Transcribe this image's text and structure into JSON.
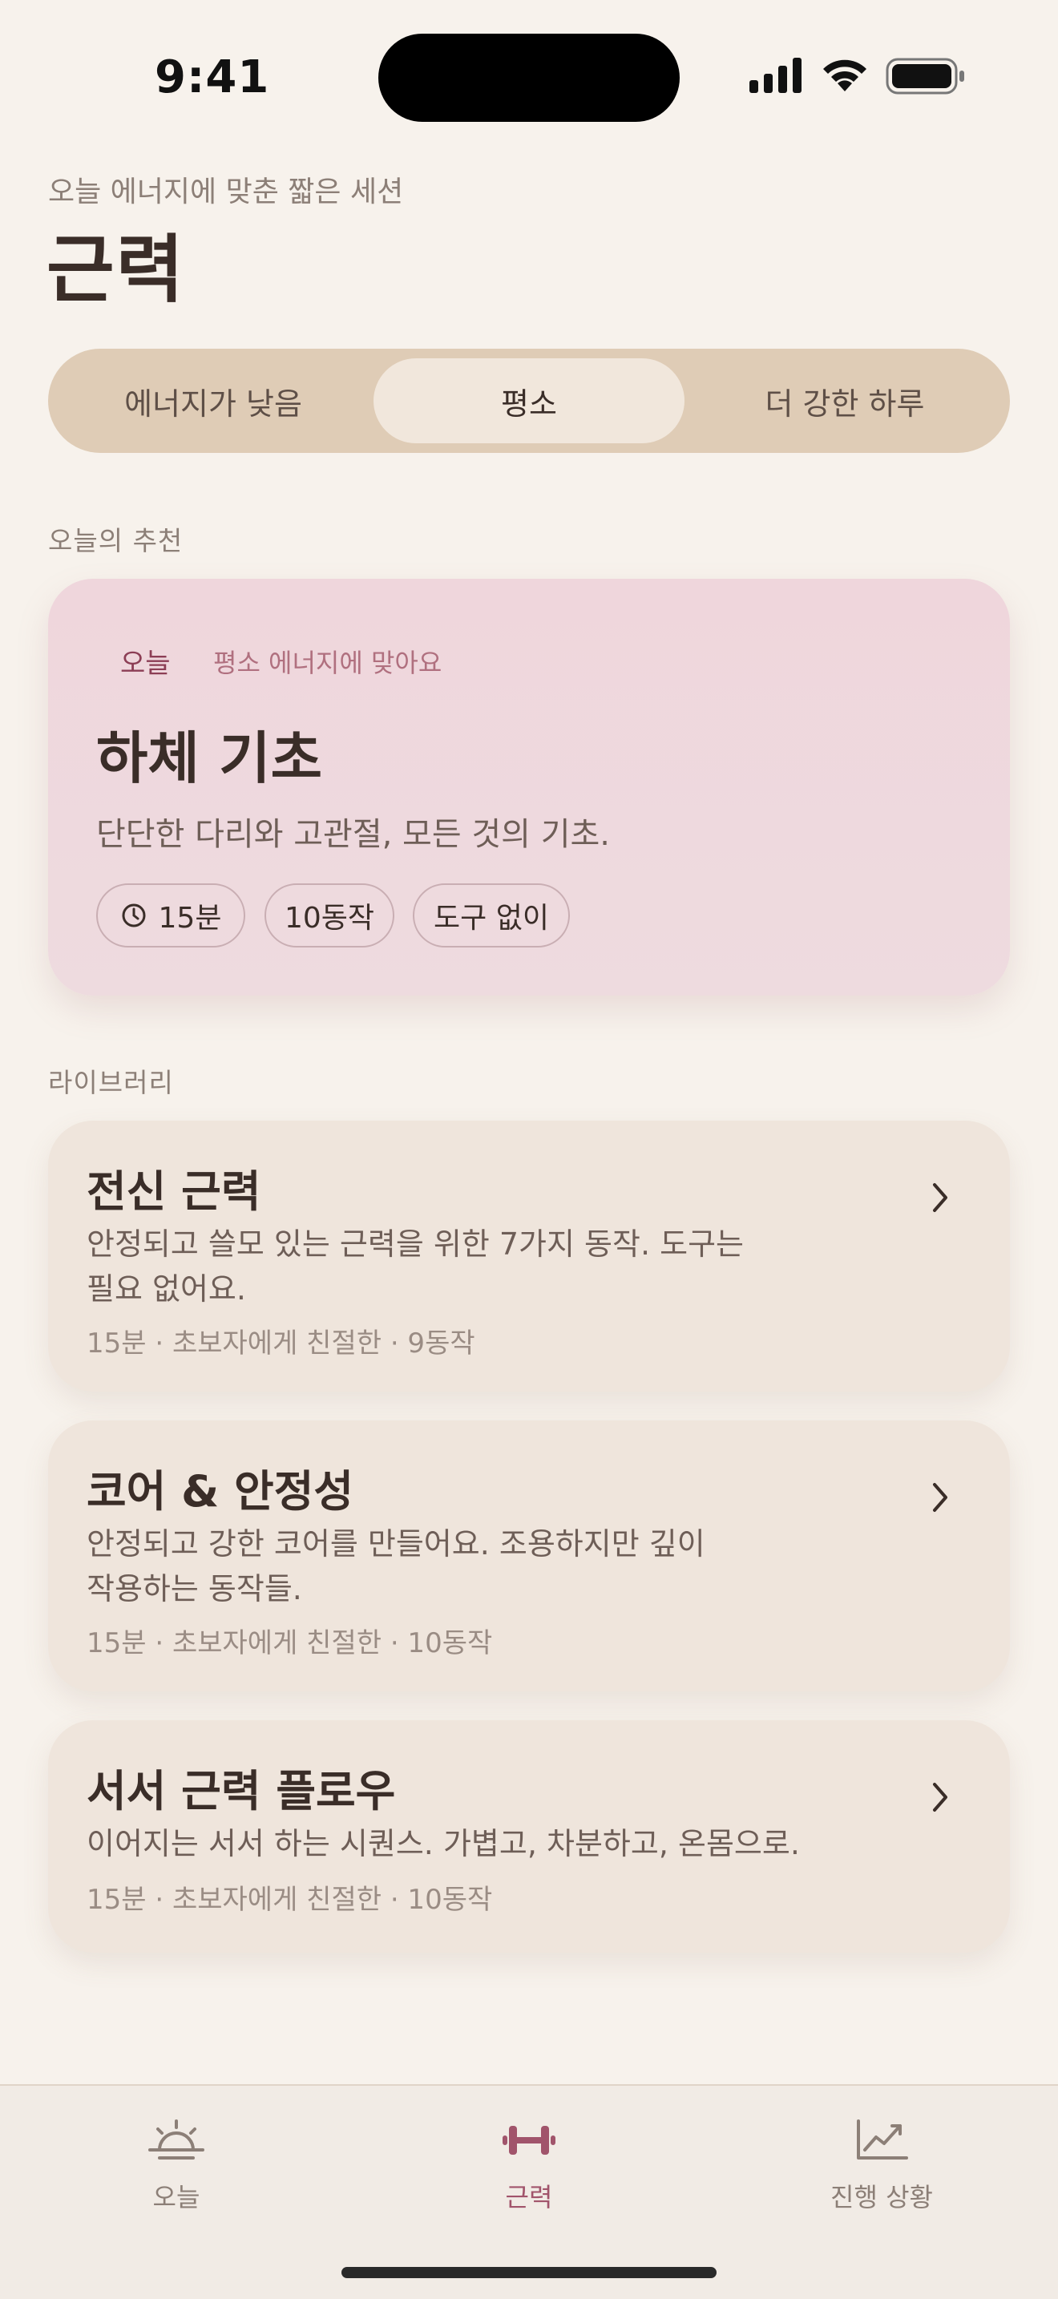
{
  "status_bar": {
    "time": "9:41"
  },
  "header": {
    "subtitle": "오늘 에너지에 맞춘 짧은 세션",
    "title": "근력"
  },
  "energy_selector": {
    "options": [
      "에너지가 낮음",
      "평소",
      "더 강한 하루"
    ],
    "selected": "평소"
  },
  "recommendation": {
    "section_label": "오늘의 추천",
    "tag": "오늘",
    "tag_note": "평소 에너지에 맞아요",
    "title": "하체 기초",
    "description": "단단한 다리와 고관절, 모든 것의 기초.",
    "pills": [
      "15분",
      "10동작",
      "도구 없이"
    ]
  },
  "library": {
    "section_label": "라이브러리",
    "items": [
      {
        "title": "전신 근력",
        "description_line1": "안정되고 쓸모 있는 근력을 위한 7가지 동작. 도구는",
        "description_line2": "필요 없어요.",
        "meta": "15분 · 초보자에게 친절한 · 9동작"
      },
      {
        "title": "코어 & 안정성",
        "description_line1": "안정되고 강한 코어를 만들어요. 조용하지만 깊이",
        "description_line2": "작용하는 동작들.",
        "meta": "15분 · 초보자에게 친절한 · 10동작"
      },
      {
        "title": "서서 근력 플로우",
        "description_line1": "이어지는 서서 하는 시퀀스. 가볍고, 차분하고, 온몸으로.",
        "meta": "15분 · 초보자에게 친절한 · 10동작"
      }
    ]
  },
  "tab_bar": {
    "tabs": [
      {
        "label": "오늘",
        "icon": "sunrise-icon"
      },
      {
        "label": "근력",
        "icon": "dumbbell-icon"
      },
      {
        "label": "진행 상황",
        "icon": "chart-line-icon"
      }
    ],
    "active": "근력"
  },
  "colors": {
    "background": "#f7f2ec",
    "accent": "#a1546b",
    "segmented_track": "#dfccb6",
    "featured_card": "#efd6dc",
    "library_card": "#efe5dc"
  }
}
